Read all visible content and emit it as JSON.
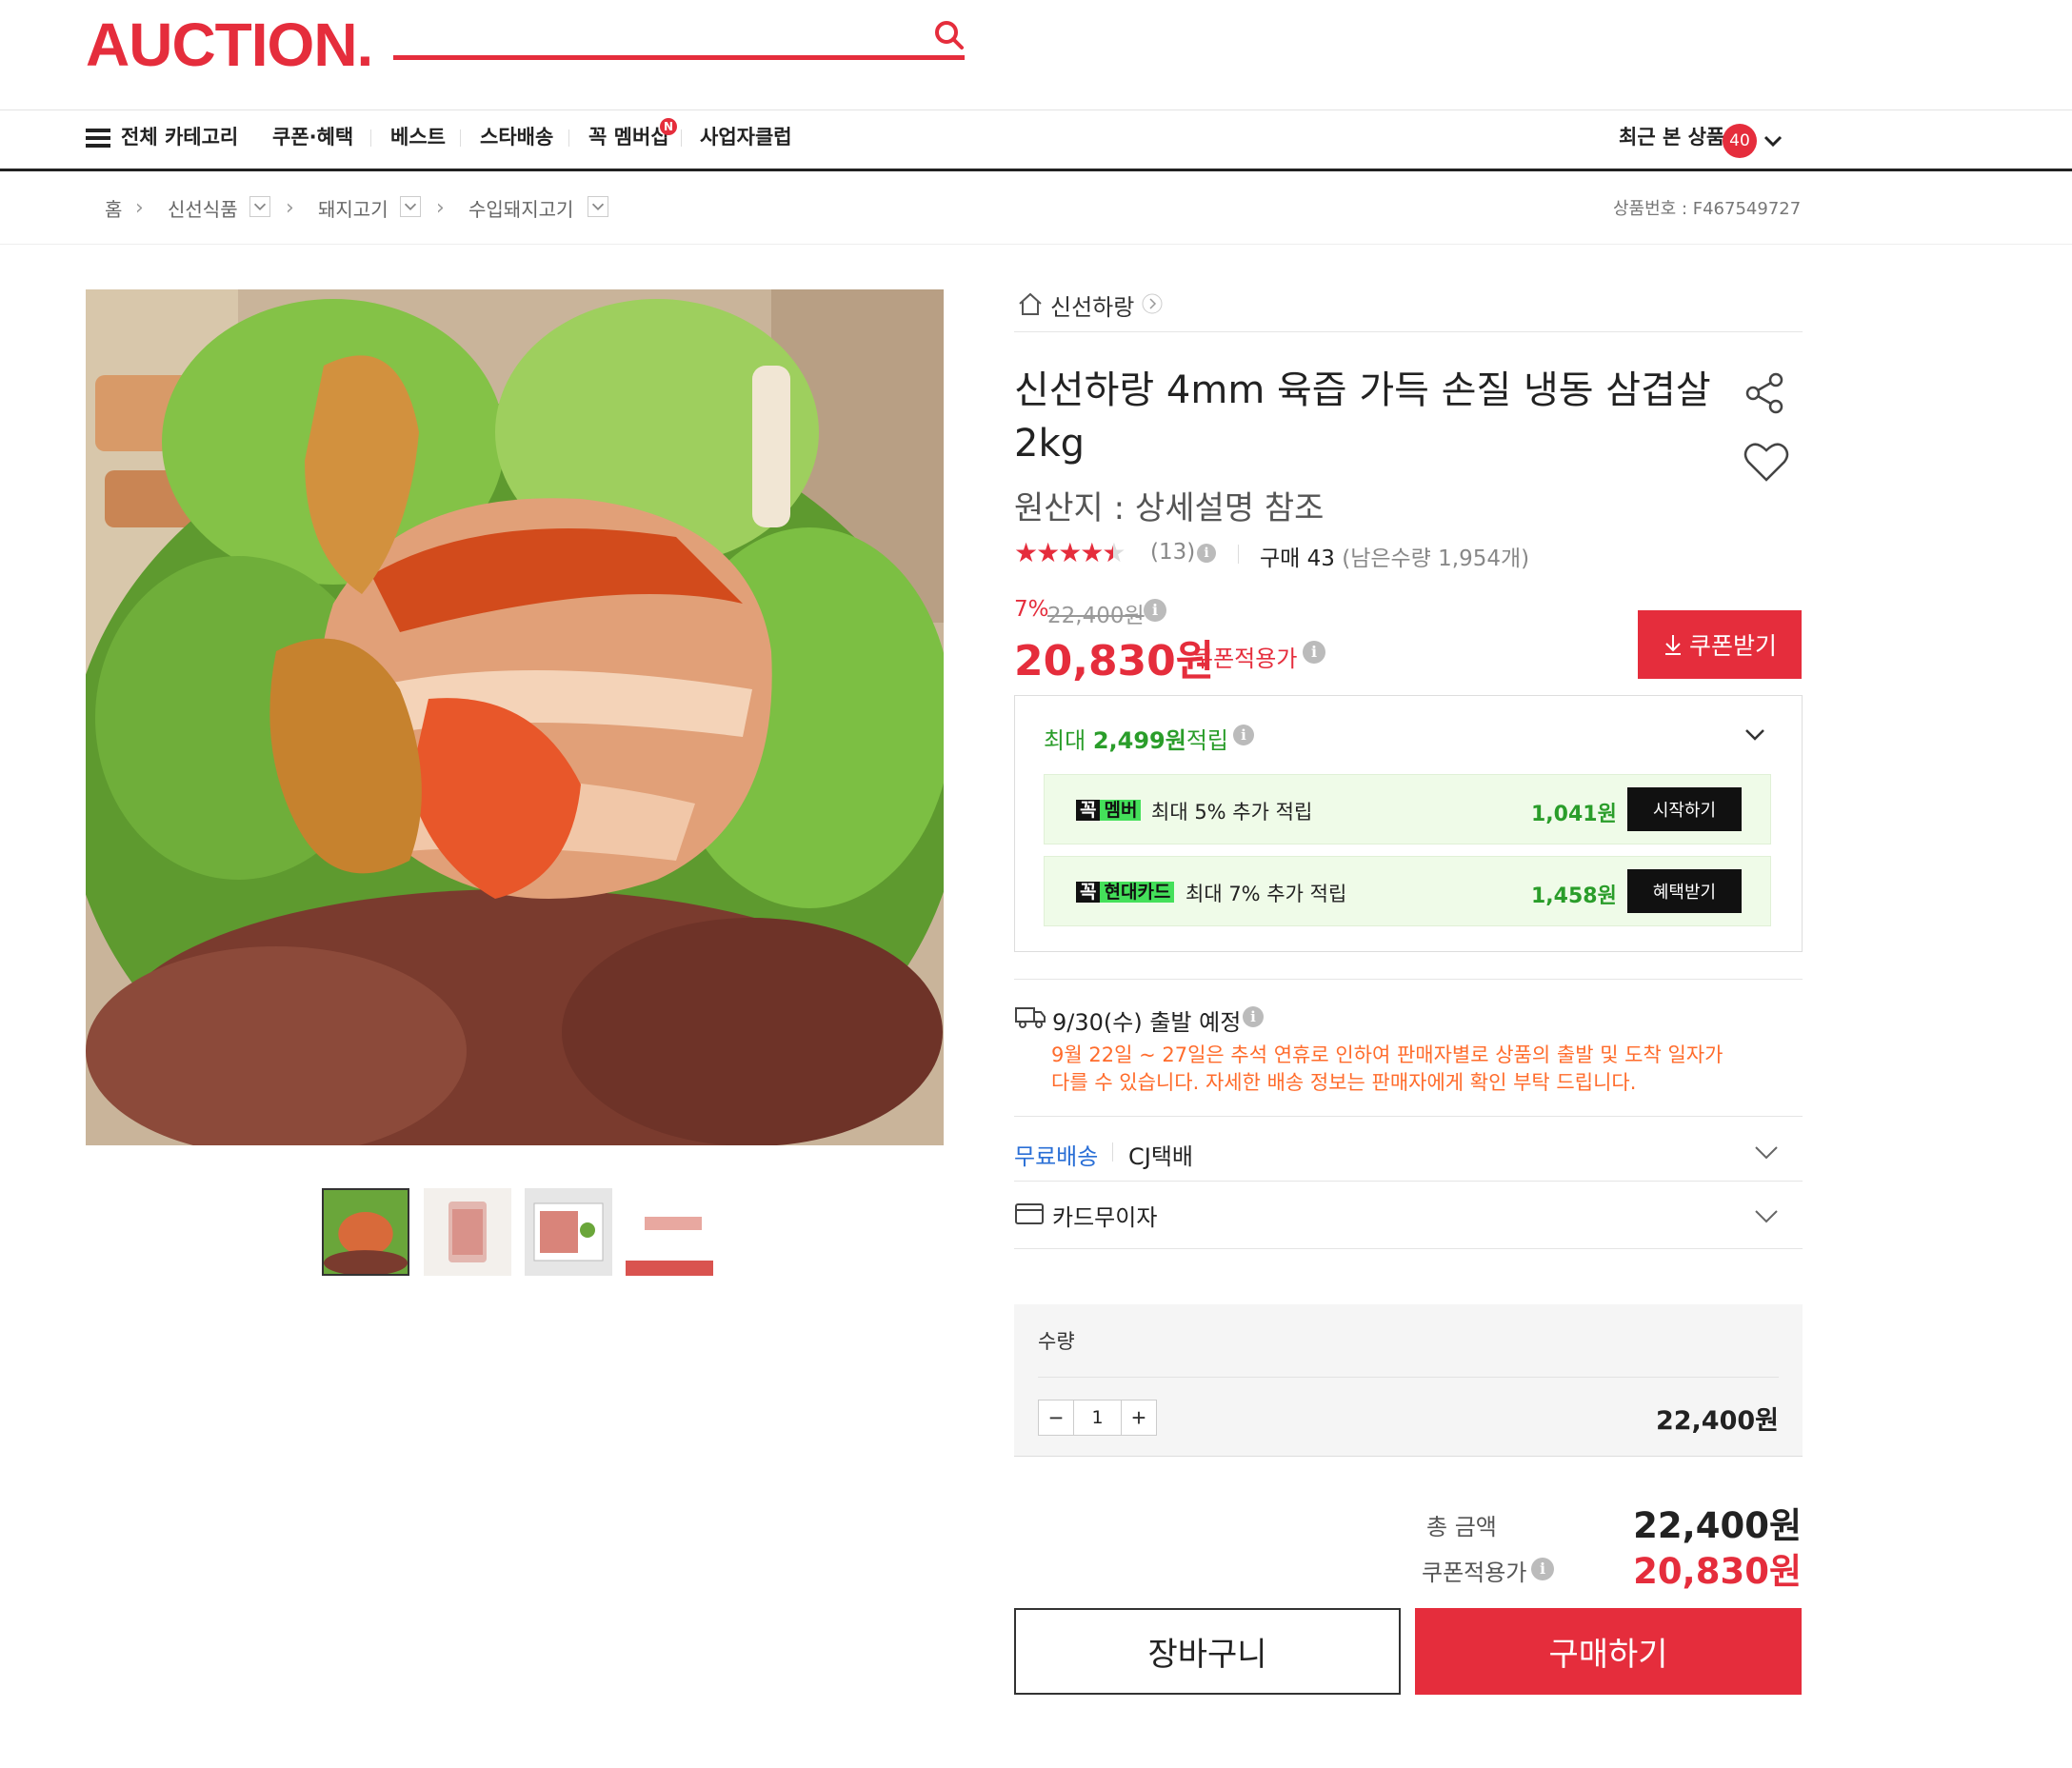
{
  "header": {
    "logo": "AUCTION.",
    "search": {
      "placeholder": ""
    }
  },
  "gnb": {
    "all_categories": "전체 카테고리",
    "menu": [
      "쿠폰·혜택",
      "베스트",
      "스타배송",
      "꼭 멤버십",
      "사업자클럽"
    ],
    "new_badge": "N",
    "recent_label": "최근 본 상품",
    "recent_count": "40"
  },
  "breadcrumb": {
    "home": "홈",
    "items": [
      "신선식품",
      "돼지고기",
      "수입돼지고기"
    ],
    "product_no": "상품번호 : F467549727"
  },
  "product": {
    "store": "신선하랑",
    "title": "신선하랑 4mm 육즙 가득 손질 냉동 삼겹살 2kg",
    "origin": "원산지 : 상세설명 참조",
    "rating": 4.5,
    "review_count": "(13)",
    "buy_label": "구매 43",
    "remain": "(남은수량 1,954개)",
    "discount": "7%",
    "original_price": "22,400원",
    "price": "20,830원",
    "coupon_price_label": "쿠폰적용가",
    "coupon_button": "쿠폰받기"
  },
  "reward": {
    "title_prefix": "최대",
    "title_amount": "2,499원",
    "title_suffix": "적립",
    "rows": [
      {
        "tag1": "꼭",
        "tag2": "멤버",
        "text": "최대 5% 추가 적립",
        "value": "1,041원",
        "button": "시작하기"
      },
      {
        "tag1": "꼭",
        "tag2": "현대카드",
        "text": "최대 7% 추가 적립",
        "value": "1,458원",
        "button": "혜택받기"
      }
    ]
  },
  "shipping": {
    "date": "9/30(수) 출발 예정",
    "notice": "9월 22일 ~ 27일은 추석 연휴로 인하여 판매자별로 상품의 출발 및 도착 일자가 다를 수 있습니다. 자세한 배송 정보는 판매자에게 확인 부탁 드립니다.",
    "free_label": "무료배송",
    "courier": "CJ택배",
    "card_label": "카드무이자"
  },
  "quantity": {
    "label": "수량",
    "value": "1",
    "price": "22,400원"
  },
  "totals": {
    "total_label": "총 금액",
    "total_value": "22,400원",
    "coupon_label": "쿠폰적용가",
    "coupon_value": "20,830원"
  },
  "actions": {
    "cart": "장바구니",
    "buy": "구매하기"
  },
  "colors": {
    "brand_red": "#e52d3c",
    "reward_green": "#2a9d2a",
    "notice_orange": "#ff6b2b",
    "link_blue": "#2a6fd6"
  }
}
